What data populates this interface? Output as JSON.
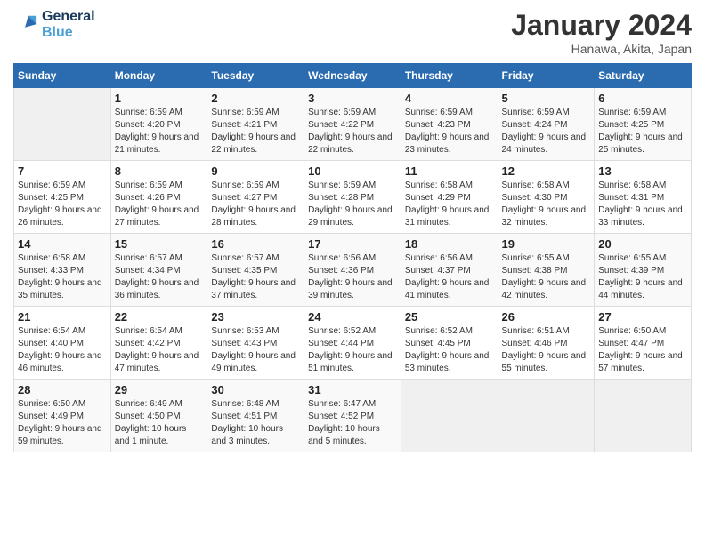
{
  "header": {
    "logo_line1": "General",
    "logo_line2": "Blue",
    "month": "January 2024",
    "location": "Hanawa, Akita, Japan"
  },
  "days_of_week": [
    "Sunday",
    "Monday",
    "Tuesday",
    "Wednesday",
    "Thursday",
    "Friday",
    "Saturday"
  ],
  "weeks": [
    [
      {
        "day": "",
        "sunrise": "",
        "sunset": "",
        "daylight": ""
      },
      {
        "day": "1",
        "sunrise": "6:59 AM",
        "sunset": "4:20 PM",
        "daylight": "9 hours and 21 minutes."
      },
      {
        "day": "2",
        "sunrise": "6:59 AM",
        "sunset": "4:21 PM",
        "daylight": "9 hours and 22 minutes."
      },
      {
        "day": "3",
        "sunrise": "6:59 AM",
        "sunset": "4:22 PM",
        "daylight": "9 hours and 22 minutes."
      },
      {
        "day": "4",
        "sunrise": "6:59 AM",
        "sunset": "4:23 PM",
        "daylight": "9 hours and 23 minutes."
      },
      {
        "day": "5",
        "sunrise": "6:59 AM",
        "sunset": "4:24 PM",
        "daylight": "9 hours and 24 minutes."
      },
      {
        "day": "6",
        "sunrise": "6:59 AM",
        "sunset": "4:25 PM",
        "daylight": "9 hours and 25 minutes."
      }
    ],
    [
      {
        "day": "7",
        "sunrise": "6:59 AM",
        "sunset": "4:25 PM",
        "daylight": "9 hours and 26 minutes."
      },
      {
        "day": "8",
        "sunrise": "6:59 AM",
        "sunset": "4:26 PM",
        "daylight": "9 hours and 27 minutes."
      },
      {
        "day": "9",
        "sunrise": "6:59 AM",
        "sunset": "4:27 PM",
        "daylight": "9 hours and 28 minutes."
      },
      {
        "day": "10",
        "sunrise": "6:59 AM",
        "sunset": "4:28 PM",
        "daylight": "9 hours and 29 minutes."
      },
      {
        "day": "11",
        "sunrise": "6:58 AM",
        "sunset": "4:29 PM",
        "daylight": "9 hours and 31 minutes."
      },
      {
        "day": "12",
        "sunrise": "6:58 AM",
        "sunset": "4:30 PM",
        "daylight": "9 hours and 32 minutes."
      },
      {
        "day": "13",
        "sunrise": "6:58 AM",
        "sunset": "4:31 PM",
        "daylight": "9 hours and 33 minutes."
      }
    ],
    [
      {
        "day": "14",
        "sunrise": "6:58 AM",
        "sunset": "4:33 PM",
        "daylight": "9 hours and 35 minutes."
      },
      {
        "day": "15",
        "sunrise": "6:57 AM",
        "sunset": "4:34 PM",
        "daylight": "9 hours and 36 minutes."
      },
      {
        "day": "16",
        "sunrise": "6:57 AM",
        "sunset": "4:35 PM",
        "daylight": "9 hours and 37 minutes."
      },
      {
        "day": "17",
        "sunrise": "6:56 AM",
        "sunset": "4:36 PM",
        "daylight": "9 hours and 39 minutes."
      },
      {
        "day": "18",
        "sunrise": "6:56 AM",
        "sunset": "4:37 PM",
        "daylight": "9 hours and 41 minutes."
      },
      {
        "day": "19",
        "sunrise": "6:55 AM",
        "sunset": "4:38 PM",
        "daylight": "9 hours and 42 minutes."
      },
      {
        "day": "20",
        "sunrise": "6:55 AM",
        "sunset": "4:39 PM",
        "daylight": "9 hours and 44 minutes."
      }
    ],
    [
      {
        "day": "21",
        "sunrise": "6:54 AM",
        "sunset": "4:40 PM",
        "daylight": "9 hours and 46 minutes."
      },
      {
        "day": "22",
        "sunrise": "6:54 AM",
        "sunset": "4:42 PM",
        "daylight": "9 hours and 47 minutes."
      },
      {
        "day": "23",
        "sunrise": "6:53 AM",
        "sunset": "4:43 PM",
        "daylight": "9 hours and 49 minutes."
      },
      {
        "day": "24",
        "sunrise": "6:52 AM",
        "sunset": "4:44 PM",
        "daylight": "9 hours and 51 minutes."
      },
      {
        "day": "25",
        "sunrise": "6:52 AM",
        "sunset": "4:45 PM",
        "daylight": "9 hours and 53 minutes."
      },
      {
        "day": "26",
        "sunrise": "6:51 AM",
        "sunset": "4:46 PM",
        "daylight": "9 hours and 55 minutes."
      },
      {
        "day": "27",
        "sunrise": "6:50 AM",
        "sunset": "4:47 PM",
        "daylight": "9 hours and 57 minutes."
      }
    ],
    [
      {
        "day": "28",
        "sunrise": "6:50 AM",
        "sunset": "4:49 PM",
        "daylight": "9 hours and 59 minutes."
      },
      {
        "day": "29",
        "sunrise": "6:49 AM",
        "sunset": "4:50 PM",
        "daylight": "10 hours and 1 minute."
      },
      {
        "day": "30",
        "sunrise": "6:48 AM",
        "sunset": "4:51 PM",
        "daylight": "10 hours and 3 minutes."
      },
      {
        "day": "31",
        "sunrise": "6:47 AM",
        "sunset": "4:52 PM",
        "daylight": "10 hours and 5 minutes."
      },
      {
        "day": "",
        "sunrise": "",
        "sunset": "",
        "daylight": ""
      },
      {
        "day": "",
        "sunrise": "",
        "sunset": "",
        "daylight": ""
      },
      {
        "day": "",
        "sunrise": "",
        "sunset": "",
        "daylight": ""
      }
    ]
  ]
}
